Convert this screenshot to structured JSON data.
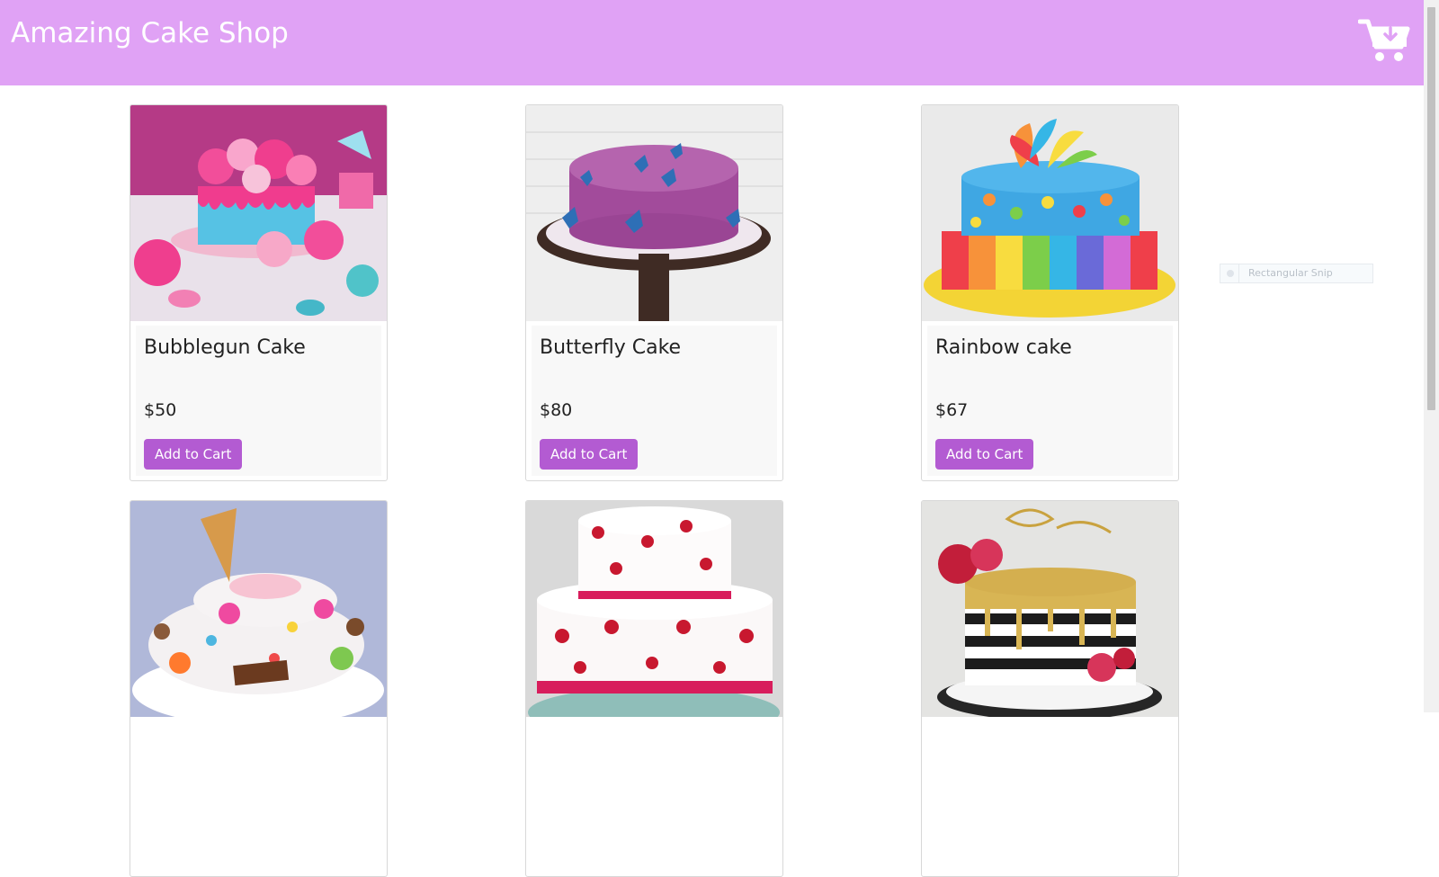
{
  "header": {
    "title": "Amazing Cake Shop",
    "cart_icon": "cart-download-icon"
  },
  "products": [
    {
      "name": "Bubblegun Cake",
      "price": "$50",
      "button": "Add to Cart",
      "image": "pink bubble cake"
    },
    {
      "name": "Butterfly Cake",
      "price": "$80",
      "button": "Add to Cart",
      "image": "purple butterfly cake"
    },
    {
      "name": "Rainbow cake",
      "price": "$67",
      "button": "Add to Cart",
      "image": "rainbow layered cake"
    },
    {
      "name": "",
      "price": "",
      "button": "",
      "image": "ice cream candy cake"
    },
    {
      "name": "",
      "price": "",
      "button": "",
      "image": "red flower two-tier cake"
    },
    {
      "name": "",
      "price": "",
      "button": "",
      "image": "gold striped birthday cake"
    }
  ],
  "snip_tool": {
    "label": "Rectangular Snip"
  },
  "colors": {
    "header": "#e0a2f5",
    "button": "#b35bd2",
    "card_body": "#f8f8f8"
  }
}
